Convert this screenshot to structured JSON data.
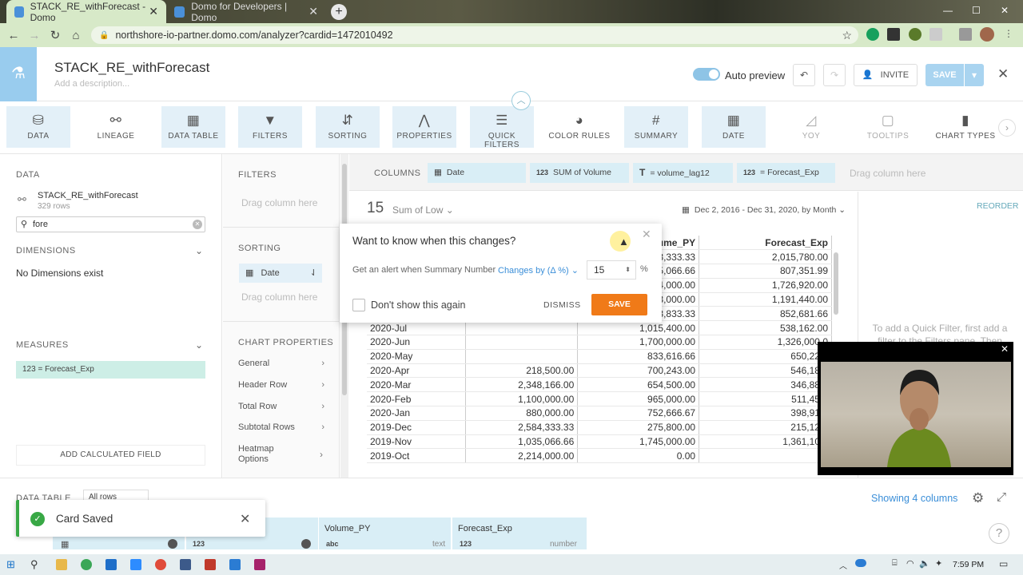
{
  "browser": {
    "tabs": [
      {
        "title": "STACK_RE_withForecast - Domo",
        "active": true
      },
      {
        "title": "Domo for Developers | Domo",
        "active": false
      }
    ],
    "url": "northshore-io-partner.domo.com/analyzer?cardid=1472010492"
  },
  "header": {
    "title": "STACK_RE_withForecast",
    "description_placeholder": "Add a description...",
    "auto_preview_label": "Auto preview",
    "invite_label": "INVITE",
    "save_label": "SAVE"
  },
  "toolbar": {
    "items": [
      {
        "label": "DATA",
        "icon": "database-icon"
      },
      {
        "label": "LINEAGE",
        "icon": "lineage-icon"
      },
      {
        "label": "DATA TABLE",
        "icon": "table-icon"
      },
      {
        "label": "FILTERS",
        "icon": "filter-icon"
      },
      {
        "label": "SORTING",
        "icon": "sort-icon"
      },
      {
        "label": "PROPERTIES",
        "icon": "compass-icon"
      },
      {
        "label": "QUICK FILTERS",
        "icon": "quick-filter-icon"
      },
      {
        "label": "COLOR RULES",
        "icon": "palette-icon"
      },
      {
        "label": "SUMMARY",
        "icon": "hash-icon"
      },
      {
        "label": "DATE",
        "icon": "calendar-icon"
      },
      {
        "label": "YOY",
        "icon": "yoy-chart-icon"
      },
      {
        "label": "TOOLTIPS",
        "icon": "tooltip-icon"
      },
      {
        "label": "CHART TYPES",
        "icon": "bar-chart-icon"
      }
    ]
  },
  "left_panel": {
    "data_heading": "DATA",
    "dataset_name": "STACK_RE_withForecast",
    "dataset_rows": "329 rows",
    "search_value": "fore",
    "dimensions_heading": "DIMENSIONS",
    "dimensions_empty": "No Dimensions exist",
    "measures_heading": "MEASURES",
    "measure_item": "123  = Forecast_Exp",
    "add_calc_label": "ADD CALCULATED FIELD"
  },
  "middle_panel": {
    "filters_heading": "FILTERS",
    "filters_drag": "Drag column here",
    "sorting_heading": "SORTING",
    "sort_item": "Date",
    "sorting_drag": "Drag column here",
    "chart_props_heading": "CHART PROPERTIES",
    "chart_props": [
      "General",
      "Header Row",
      "Total Row",
      "Subtotal Rows",
      "Heatmap Options"
    ]
  },
  "columns_bar": {
    "label": "COLUMNS",
    "pills": [
      {
        "type_icon": "calendar-icon",
        "label": "Date"
      },
      {
        "type_icon": "123",
        "label": "SUM of Volume"
      },
      {
        "type_icon": "T",
        "label": "= volume_lag12"
      },
      {
        "type_icon": "123",
        "label": "= Forecast_Exp"
      }
    ],
    "drag": "Drag column here"
  },
  "summary": {
    "number": "15",
    "label": "Sum of Low",
    "date_range": "Dec 2, 2016 - Dec 31, 2020, by Month",
    "reorder_label": "REORDER"
  },
  "table": {
    "headers": [
      "",
      "",
      "lume_PY",
      "Forecast_Exp"
    ],
    "rows": [
      [
        "",
        "",
        "3,333.33",
        "2,015,780.00"
      ],
      [
        "",
        "",
        "5,066.66",
        "807,351.99"
      ],
      [
        "",
        "",
        "4,000.00",
        "1,726,920.00"
      ],
      [
        "",
        "",
        "3,000.00",
        "1,191,440.00"
      ],
      [
        "",
        "",
        "3,833.33",
        "852,681.66"
      ],
      [
        "2020-Jul",
        "",
        "1,015,400.00",
        "538,162.00"
      ],
      [
        "2020-Jun",
        "",
        "1,700,000.00",
        "1,326,000.0"
      ],
      [
        "2020-May",
        "",
        "833,616.66",
        "650,220."
      ],
      [
        "2020-Apr",
        "218,500.00",
        "700,243.00",
        "546,189."
      ],
      [
        "2020-Mar",
        "2,348,166.00",
        "654,500.00",
        "346,885."
      ],
      [
        "2020-Feb",
        "1,100,000.00",
        "965,000.00",
        "511,450."
      ],
      [
        "2020-Jan",
        "880,000.00",
        "752,666.67",
        "398,913."
      ],
      [
        "2019-Dec",
        "2,584,333.33",
        "275,800.00",
        "215,124."
      ],
      [
        "2019-Nov",
        "1,035,066.66",
        "1,745,000.00",
        "1,361,100."
      ],
      [
        "2019-Oct",
        "2,214,000.00",
        "0.00",
        "0."
      ]
    ]
  },
  "quick_filter_hint": "To add a Quick Filter, first add a filter to the Filters pane. Then",
  "alert_popup": {
    "title": "Want to know when this changes?",
    "text": "Get an alert when Summary Number",
    "change_option": "Changes by (Δ %)",
    "value": "15",
    "unit": "%",
    "checkbox_label": "Don't show this again",
    "dismiss_label": "DISMISS",
    "save_label": "SAVE"
  },
  "bottom": {
    "data_table_label": "DATA TABLE",
    "rows_option": "All rows",
    "showing_columns": "Showing 4 columns",
    "columns": [
      {
        "name": "",
        "type_icon": "calendar-icon",
        "type": ""
      },
      {
        "name": "",
        "type_icon": "123",
        "type": ""
      },
      {
        "name": "Volume_PY",
        "type_icon": "abc",
        "type": "text"
      },
      {
        "name": "Forecast_Exp",
        "type_icon": "123",
        "type": "number"
      }
    ]
  },
  "toast": {
    "message": "Card Saved"
  },
  "taskbar": {
    "time": "7:59 PM"
  }
}
